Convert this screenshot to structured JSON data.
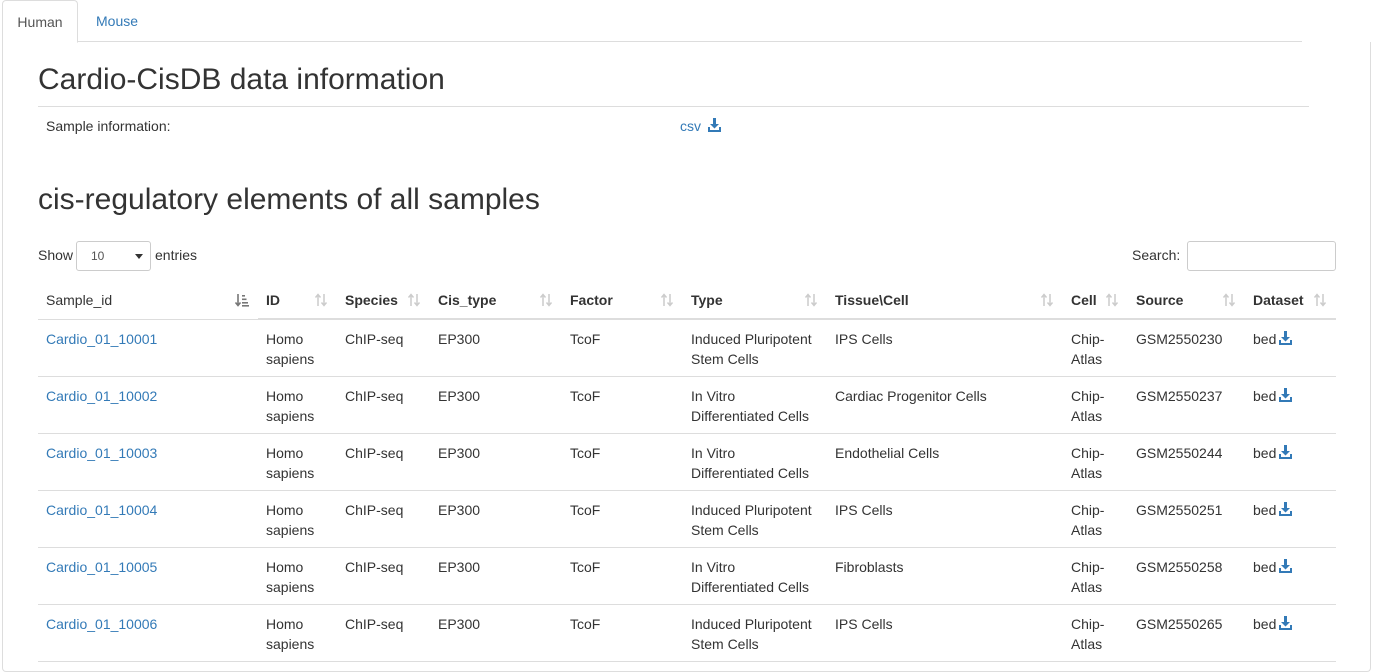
{
  "tabs": [
    {
      "label": "Human"
    },
    {
      "label": "Mouse"
    }
  ],
  "info": {
    "title": "Cardio-CisDB data information",
    "sample_label": "Sample information:",
    "csv_label": "csv"
  },
  "cis": {
    "title": "cis-regulatory elements of all samples",
    "show_label": "Show",
    "entries_label": "entries",
    "page_length": "10",
    "search_label": "Search:",
    "search_value": ""
  },
  "table": {
    "headers": {
      "sample_id": "Sample_id",
      "id": "ID",
      "species": "Species",
      "cis_type": "Cis_type",
      "factor": "Factor",
      "type": "Type",
      "tissue": "Tissue\\Cell",
      "cell": "Cell",
      "source": "Source",
      "dataset": "Dataset"
    },
    "rows": [
      {
        "sample_id": "Cardio_01_10001",
        "species1": "Homo",
        "species2": "sapiens",
        "cis_type": "ChIP-seq",
        "factor": "EP300",
        "class": "TcoF",
        "type1": "Induced Pluripotent",
        "type2": "Stem Cells",
        "tissue": "IPS Cells",
        "cell1": "Chip-",
        "cell2": "Atlas",
        "source": "GSM2550230",
        "dataset": "bed"
      },
      {
        "sample_id": "Cardio_01_10002",
        "species1": "Homo",
        "species2": "sapiens",
        "cis_type": "ChIP-seq",
        "factor": "EP300",
        "class": "TcoF",
        "type1": "In Vitro",
        "type2": "Differentiated Cells",
        "tissue": "Cardiac Progenitor Cells",
        "cell1": "Chip-",
        "cell2": "Atlas",
        "source": "GSM2550237",
        "dataset": "bed"
      },
      {
        "sample_id": "Cardio_01_10003",
        "species1": "Homo",
        "species2": "sapiens",
        "cis_type": "ChIP-seq",
        "factor": "EP300",
        "class": "TcoF",
        "type1": "In Vitro",
        "type2": "Differentiated Cells",
        "tissue": "Endothelial Cells",
        "cell1": "Chip-",
        "cell2": "Atlas",
        "source": "GSM2550244",
        "dataset": "bed"
      },
      {
        "sample_id": "Cardio_01_10004",
        "species1": "Homo",
        "species2": "sapiens",
        "cis_type": "ChIP-seq",
        "factor": "EP300",
        "class": "TcoF",
        "type1": "Induced Pluripotent",
        "type2": "Stem Cells",
        "tissue": "IPS Cells",
        "cell1": "Chip-",
        "cell2": "Atlas",
        "source": "GSM2550251",
        "dataset": "bed"
      },
      {
        "sample_id": "Cardio_01_10005",
        "species1": "Homo",
        "species2": "sapiens",
        "cis_type": "ChIP-seq",
        "factor": "EP300",
        "class": "TcoF",
        "type1": "In Vitro",
        "type2": "Differentiated Cells",
        "tissue": "Fibroblasts",
        "cell1": "Chip-",
        "cell2": "Atlas",
        "source": "GSM2550258",
        "dataset": "bed"
      },
      {
        "sample_id": "Cardio_01_10006",
        "species1": "Homo",
        "species2": "sapiens",
        "cis_type": "ChIP-seq",
        "factor": "EP300",
        "class": "TcoF",
        "type1": "Induced Pluripotent",
        "type2": "Stem Cells",
        "tissue": "IPS Cells",
        "cell1": "Chip-",
        "cell2": "Atlas",
        "source": "GSM2550265",
        "dataset": "bed"
      }
    ]
  },
  "colors": {
    "link": "#337ab7",
    "text": "#333333",
    "border": "#dddddd",
    "sort_icon_inactive": "#cccccc",
    "sort_icon_active": "#888888"
  },
  "icons": {
    "download": "download-icon",
    "sort": "sort-both-icon",
    "sort_active": "sort-ascending-icon"
  }
}
